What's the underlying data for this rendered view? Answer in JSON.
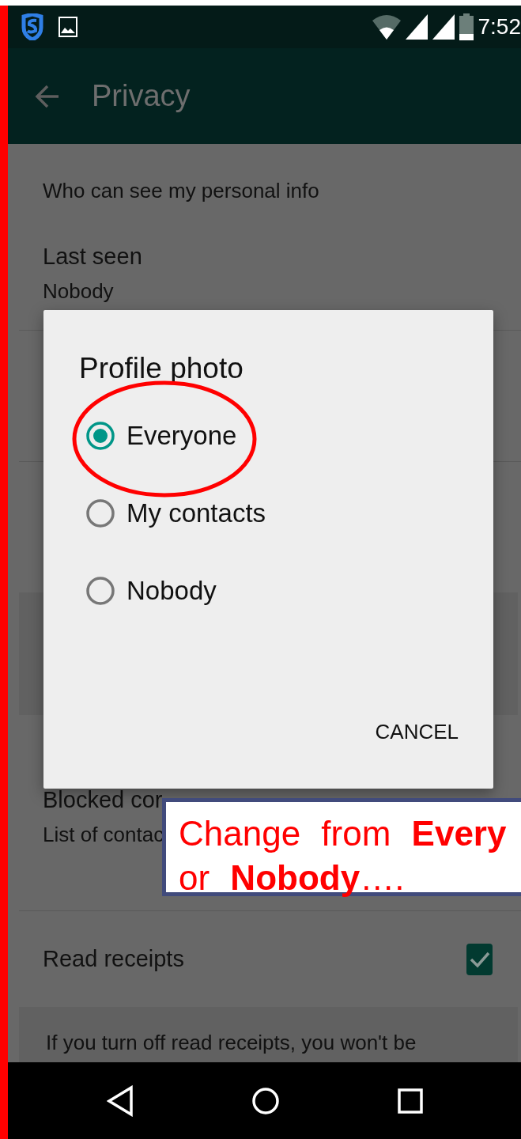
{
  "status_bar": {
    "time": "7:52"
  },
  "app_bar": {
    "title": "Privacy"
  },
  "settings": {
    "section_header": "Who can see my personal info",
    "last_seen": {
      "title": "Last seen",
      "value": "Nobody"
    },
    "blocked_contacts": {
      "title": "Blocked cor",
      "subtitle": "List of contac"
    },
    "read_receipts": {
      "title": "Read receipts",
      "checked": true,
      "note": "If you turn off read receipts, you won't be"
    }
  },
  "dialog": {
    "title": "Profile photo",
    "options": [
      {
        "label": "Everyone",
        "selected": true
      },
      {
        "label": "My contacts",
        "selected": false
      },
      {
        "label": "Nobody",
        "selected": false
      }
    ],
    "cancel": "CANCEL"
  },
  "annotation": {
    "lines": [
      "Change from **Every**",
      "or **Nobody**…."
    ]
  }
}
